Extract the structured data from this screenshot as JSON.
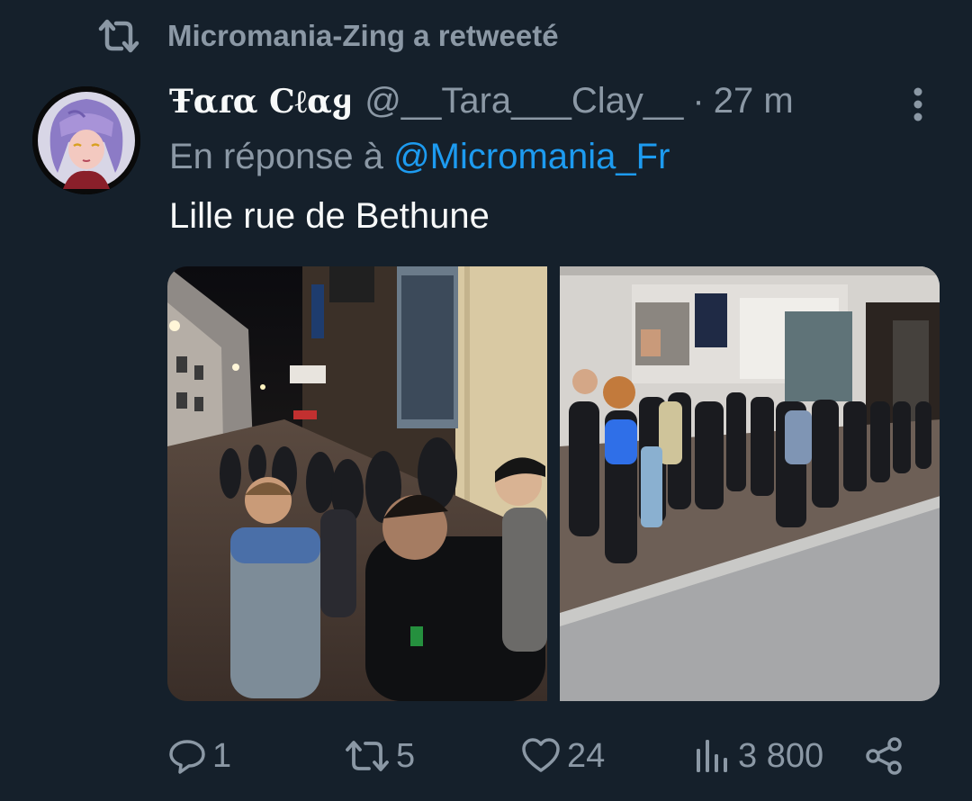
{
  "retweet_context": {
    "icon": "retweet-icon",
    "text": "Micromania-Zing a retweeté"
  },
  "tweet": {
    "author": {
      "display_name": "Ŧαɾα Cℓαყ",
      "handle": "@__Tara___Clay__",
      "avatar": "avatar-illustration"
    },
    "separator": "·",
    "time": "27 m",
    "reply_prefix": "En réponse à",
    "reply_mention": "@Micromania_Fr",
    "text": "Lille rue de Bethune",
    "media": [
      {
        "kind": "photo",
        "description_icon": "night-street-queue-photo"
      },
      {
        "kind": "photo",
        "description_icon": "storefront-queue-photo"
      }
    ]
  },
  "actions": {
    "reply_count": "1",
    "retweet_count": "5",
    "like_count": "24",
    "views_count": "3 800"
  },
  "colors": {
    "background": "#15202b",
    "primary_text": "#f7f9f9",
    "secondary_text": "#8b98a5",
    "accent": "#1d9bf0"
  }
}
